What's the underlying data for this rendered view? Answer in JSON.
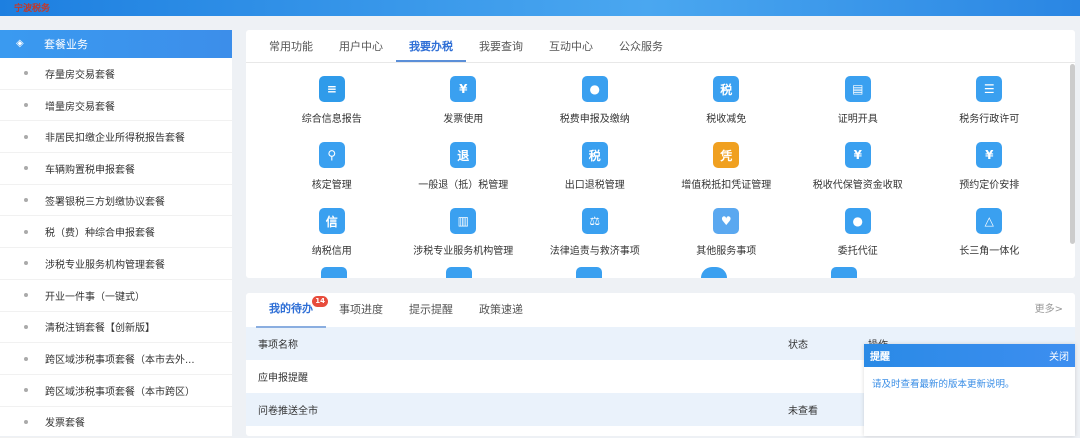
{
  "header": {
    "logo": "宁波税务"
  },
  "sidebar": {
    "title": "套餐业务",
    "items": [
      "存量房交易套餐",
      "增量房交易套餐",
      "非居民扣缴企业所得税报告套餐",
      "车辆购置税申报套餐",
      "签署银税三方划缴协议套餐",
      "税（费）种综合申报套餐",
      "涉税专业服务机构管理套餐",
      "开业一件事（一键式）",
      "清税注销套餐【创新版】",
      "跨区域涉税事项套餐（本市去外...",
      "跨区域涉税事项套餐（本市跨区）",
      "发票套餐"
    ]
  },
  "top": {
    "tabs": [
      "常用功能",
      "用户中心",
      "我要办税",
      "我要查询",
      "互动中心",
      "公众服务"
    ],
    "active_tab": 2,
    "functions": [
      {
        "label": "综合信息报告",
        "glyph": "≡",
        "color": "#2f9bea"
      },
      {
        "label": "发票使用",
        "glyph": "¥",
        "color": "#3aa0f0"
      },
      {
        "label": "税费申报及缴纳",
        "glyph": "●",
        "color": "#3aa0f0"
      },
      {
        "label": "税收减免",
        "glyph": "税",
        "color": "#3aa0f0"
      },
      {
        "label": "证明开具",
        "glyph": "▤",
        "color": "#3aa0f0"
      },
      {
        "label": "税务行政许可",
        "glyph": "☰",
        "color": "#3aa0f0"
      },
      {
        "label": "核定管理",
        "glyph": "⚲",
        "color": "#3aa0f0"
      },
      {
        "label": "一般退（抵）税管理",
        "glyph": "退",
        "color": "#3aa0f0"
      },
      {
        "label": "出口退税管理",
        "glyph": "税",
        "color": "#3aa0f0"
      },
      {
        "label": "增值税抵扣凭证管理",
        "glyph": "凭",
        "color": "#f0a020"
      },
      {
        "label": "税收代保管资金收取",
        "glyph": "¥",
        "color": "#3aa0f0"
      },
      {
        "label": "预约定价安排",
        "glyph": "¥",
        "color": "#3aa0f0"
      },
      {
        "label": "纳税信用",
        "glyph": "信",
        "color": "#3aa0f0"
      },
      {
        "label": "涉税专业服务机构管理",
        "glyph": "▥",
        "color": "#3aa0f0"
      },
      {
        "label": "法律追责与救济事项",
        "glyph": "⚖",
        "color": "#3aa0f0"
      },
      {
        "label": "其他服务事项",
        "glyph": "♥",
        "color": "#5aa8f0"
      },
      {
        "label": "委托代征",
        "glyph": "●",
        "color": "#3aa0f0"
      },
      {
        "label": "长三角一体化",
        "glyph": "△",
        "color": "#3aa0f0"
      }
    ]
  },
  "bottom": {
    "tabs": [
      "我的待办",
      "事项进度",
      "提示提醒",
      "政策速递"
    ],
    "badge": "14",
    "more": "更多>",
    "columns": [
      "事项名称",
      "状态",
      "操作"
    ],
    "rows": [
      {
        "name": "应申报提醒",
        "status": ""
      },
      {
        "name": "问卷推送全市",
        "status": "未查看"
      }
    ]
  },
  "popup": {
    "title": "提醒",
    "close": "关闭",
    "message": "请及时查看最新的版本更新说明。"
  }
}
